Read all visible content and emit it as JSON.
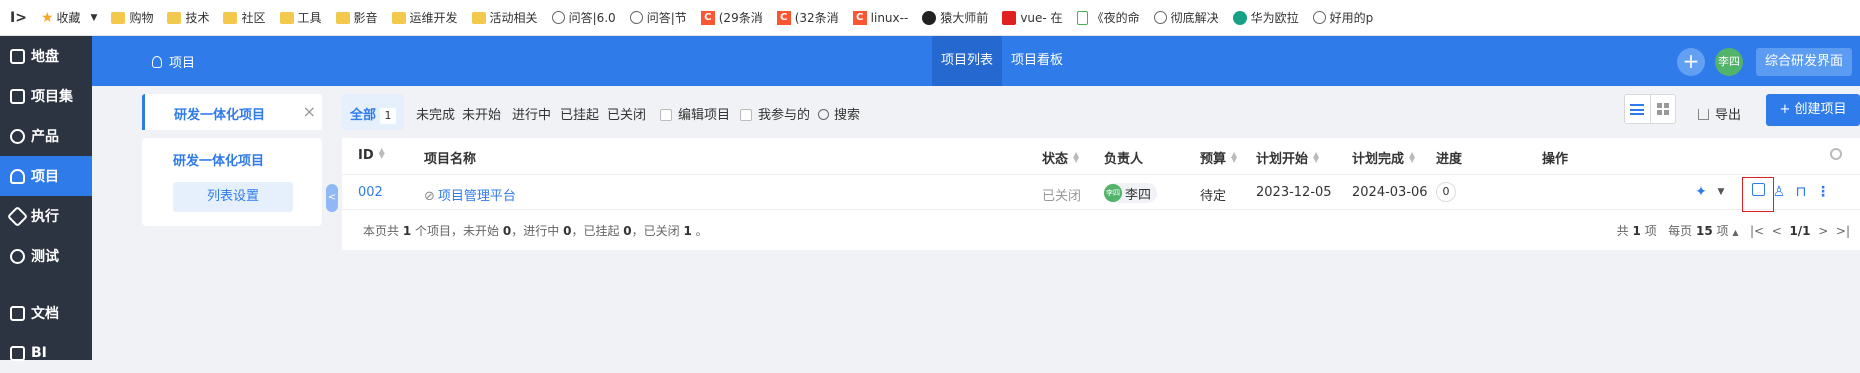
{
  "bookmarks": [
    "收藏",
    "购物",
    "技术",
    "社区",
    "工具",
    "影音",
    "运维开发",
    "活动相关",
    "问答|6.0",
    "问答|节",
    "(29条消",
    "(32条消",
    "linux--",
    "猿大师前",
    "vue- 在",
    "《夜的命",
    "彻底解决",
    "华为欧拉",
    "好用的p"
  ],
  "sidebar": [
    "地盘",
    "项目集",
    "产品",
    "项目",
    "执行",
    "测试",
    "文档",
    "BI"
  ],
  "topbar": {
    "project_label": "项目",
    "tabs": [
      "项目列表",
      "项目看板"
    ],
    "avatar": "李四",
    "integrated_btn": "综合研发界面",
    "plus": "+"
  },
  "leftpanel": {
    "title": "研发一体化项目",
    "close": "×",
    "item": "研发一体化项目",
    "settings_btn": "列表设置"
  },
  "filters": {
    "all": "全部",
    "all_count": "1",
    "unfinished": "未完成",
    "not_started": "未开始",
    "in_progress": "进行中",
    "suspended": "已挂起",
    "closed": "已关闭",
    "edit_project": "编辑项目",
    "participated": "我参与的",
    "search": "搜索"
  },
  "toolbar": {
    "export": "导出",
    "create": "+ 创建项目"
  },
  "table": {
    "headers": {
      "id": "ID",
      "name": "项目名称",
      "status": "状态",
      "owner": "负责人",
      "budget": "预算",
      "plan_start": "计划开始",
      "plan_end": "计划完成",
      "progress": "进度",
      "actions": "操作"
    },
    "row": {
      "id": "002",
      "name": "项目管理平台",
      "status": "已关闭",
      "owner": "李四",
      "owner_avatar": "李四",
      "budget": "待定",
      "plan_start": "2023-12-05",
      "plan_end": "2024-03-06",
      "progress": "0"
    }
  },
  "footer": {
    "summary_prefix": "本页共",
    "total": "1",
    "summary_mid1": "个项目，未开始",
    "not_started": "0",
    "summary_mid2": "，进行中",
    "in_progress": "0",
    "summary_mid3": "，已挂起",
    "suspended": "0",
    "summary_mid4": "，已关闭",
    "closed": "1",
    "summary_end": "。",
    "total_items_prefix": "共",
    "total_items": "1",
    "total_items_suffix": "项",
    "per_page_prefix": "每页",
    "per_page": "15",
    "per_page_suffix": "项",
    "page": "1/1"
  }
}
